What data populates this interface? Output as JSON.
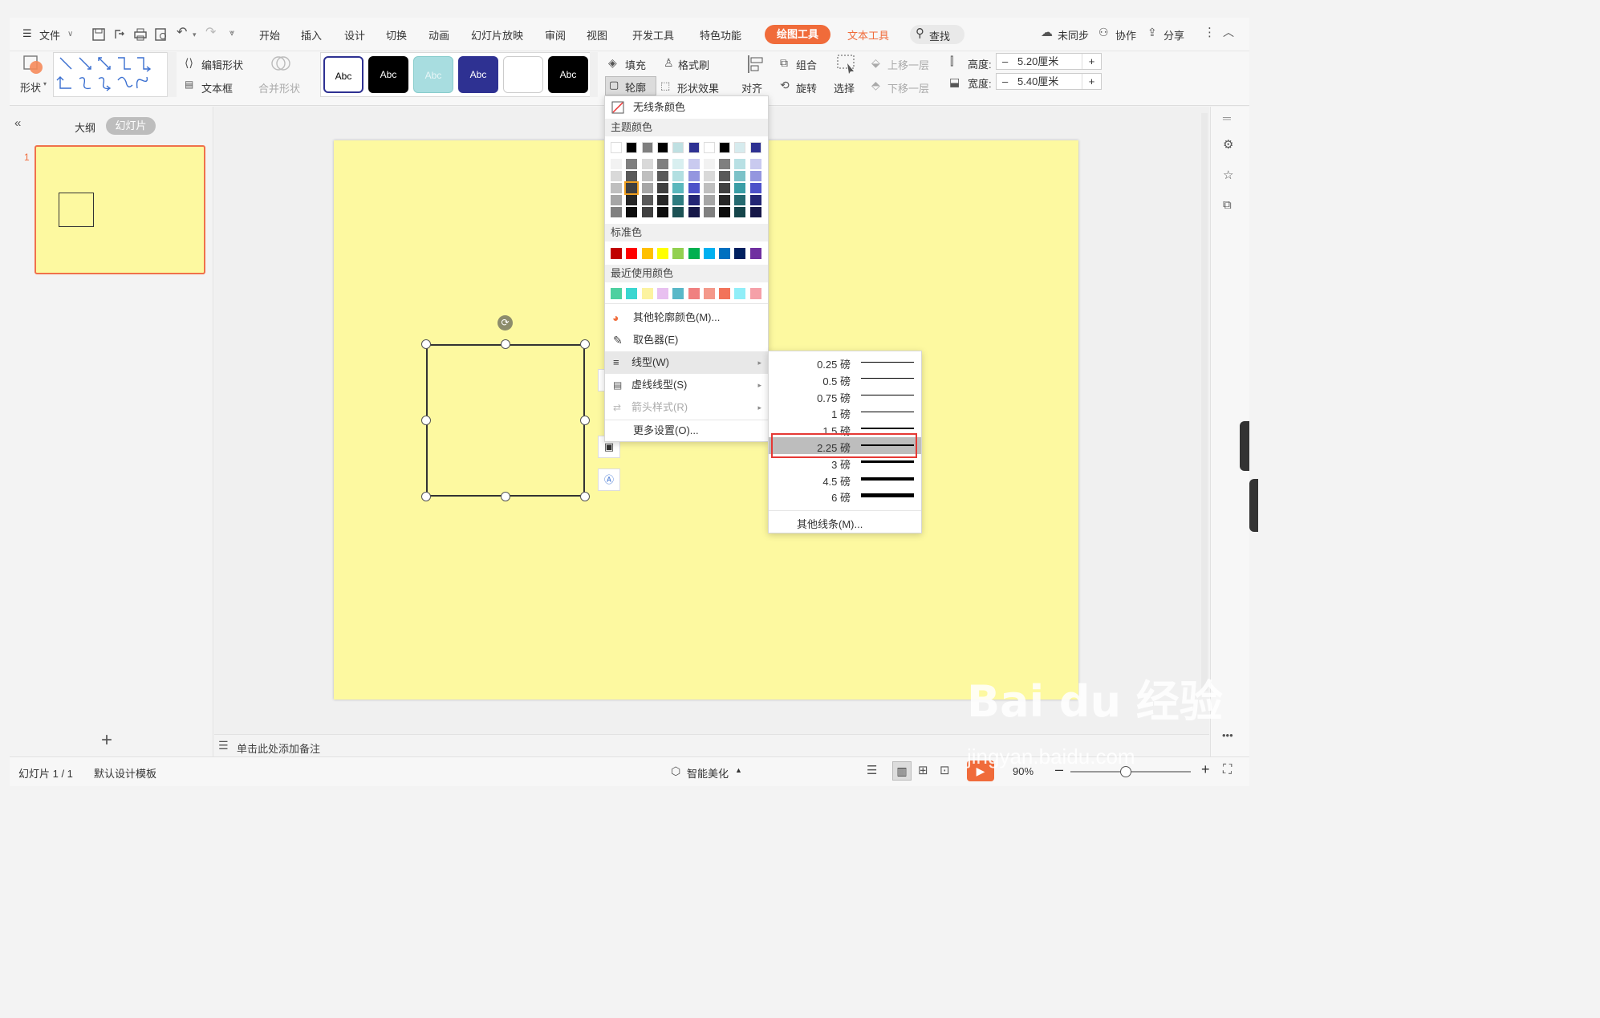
{
  "titlebar": {
    "menu_label": "文件",
    "tabs": [
      "开始",
      "插入",
      "设计",
      "切换",
      "动画",
      "幻灯片放映",
      "审阅",
      "视图",
      "开发工具",
      "特色功能"
    ],
    "active_tab": "绘图工具",
    "text_tools_tab": "文本工具",
    "search": "查找",
    "sync": "未同步",
    "collab": "协作",
    "share": "分享"
  },
  "ribbon": {
    "shape": "形状",
    "edit_shape": "编辑形状",
    "textbox": "文本框",
    "merge_shape": "合并形状",
    "style_samples": [
      "Abc",
      "Abc",
      "Abc",
      "Abc",
      "",
      "Abc"
    ],
    "fill": "填充",
    "format_painter": "格式刷",
    "outline": "轮廓",
    "shape_effect": "形状效果",
    "align": "对齐",
    "group": "组合",
    "rotate": "旋转",
    "select": "选择",
    "bring_forward": "上移一层",
    "send_backward": "下移一层",
    "height_label": "高度:",
    "height_value": "5.20厘米",
    "width_label": "宽度:",
    "width_value": "5.40厘米"
  },
  "left_pane": {
    "outline_tab": "大纲",
    "slides_tab": "幻灯片",
    "slide_number": "1"
  },
  "outline_menu": {
    "no_line": "无线条颜色",
    "theme_colors": "主题颜色",
    "standard_colors": "标准色",
    "recent_colors": "最近使用颜色",
    "more_colors": "其他轮廓颜色(M)...",
    "eyedropper": "取色器(E)",
    "line_style": "线型(W)",
    "dash_style": "虚线线型(S)",
    "arrow_style": "箭头样式(R)",
    "more_settings": "更多设置(O)...",
    "theme_top_row": [
      "#ffffff",
      "#000000",
      "#7f7f7f",
      "#000000",
      "#bfe0e2",
      "#2e3192",
      "#ffffff",
      "#000000",
      "#d6ebee",
      "#2e3192"
    ],
    "standard": [
      "#c00000",
      "#ff0000",
      "#ffc000",
      "#ffff00",
      "#92d050",
      "#00b050",
      "#00b0f0",
      "#0070c0",
      "#002060",
      "#7030a0"
    ],
    "recent": [
      "#4dd0a0",
      "#3ad6d0",
      "#fcf3a0",
      "#e8c0f0",
      "#58b8c8",
      "#f08080",
      "#f4988a",
      "#f2735a",
      "#90eef8",
      "#f5a0a8"
    ]
  },
  "line_weights": {
    "items": [
      "0.25 磅",
      "0.5 磅",
      "0.75 磅",
      "1 磅",
      "1.5 磅",
      "2.25 磅",
      "3 磅",
      "4.5 磅",
      "6 磅"
    ],
    "selected": "2.25 磅",
    "more_lines": "其他线条(M)..."
  },
  "status": {
    "slide_count": "幻灯片 1 / 1",
    "template": "默认设计模板",
    "beautify": "智能美化",
    "zoom": "90%",
    "notes_placeholder": "单击此处添加备注"
  },
  "watermark": {
    "brand": "Bai du 经验",
    "url": "jingyan.baidu.com"
  }
}
